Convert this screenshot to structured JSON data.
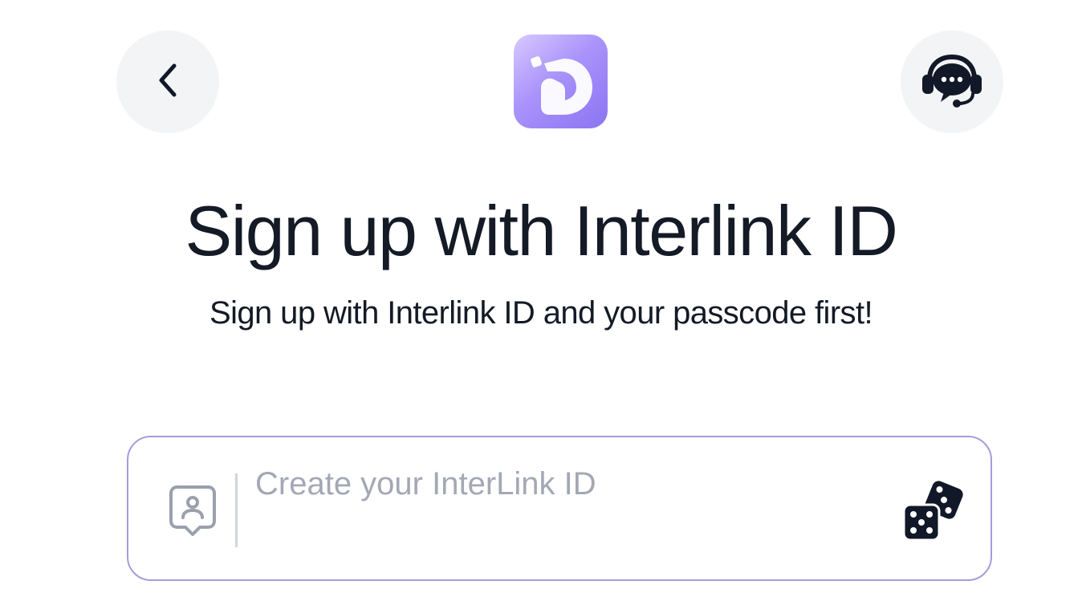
{
  "header": {
    "back_icon": "chevron-left-icon",
    "logo_icon": "interlink-logo",
    "support_icon": "headset-chat-icon"
  },
  "main": {
    "title": "Sign up with Interlink ID",
    "subtitle": "Sign up with Interlink ID and your passcode first!"
  },
  "id_field": {
    "value": "",
    "placeholder": "Create your InterLink ID",
    "leading_icon": "user-badge-icon",
    "trailing_icon": "dice-icon"
  },
  "colors": {
    "accent_border": "#a39ddb",
    "logo_gradient_start": "#d7c9ff",
    "logo_gradient_end": "#8b74f2",
    "text": "#141a26",
    "placeholder": "#a3a8b4"
  }
}
